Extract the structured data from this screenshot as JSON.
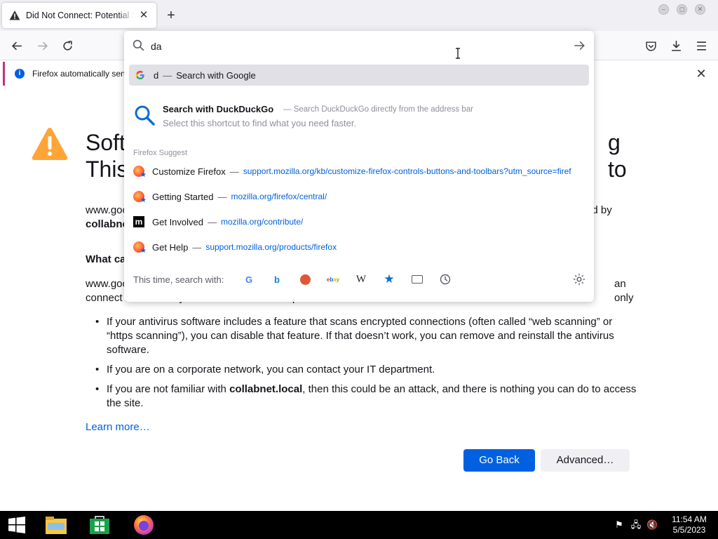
{
  "window": {
    "tab_title": "Did Not Connect: Potential Security Issue",
    "new_tab_symbol": "+"
  },
  "notification": {
    "text": "Firefox automatically sen"
  },
  "page": {
    "heading_line1": "Soft",
    "heading_line2": "This",
    "heading_tail": "g to",
    "para1_start": "www.goo",
    "para1_end": "ed by",
    "para1_bold": "collabne",
    "what_heading": "What ca",
    "para2_start": "www.goo",
    "para2_end": "an only",
    "para2_line2": "connect to it securely. You can’t add an exception to visit this site.",
    "bullets": [
      "If your antivirus software includes a feature that scans encrypted connections (often called “web scanning” or “https scanning”), you can disable that feature. If that doesn’t work, you can remove and reinstall the antivirus software.",
      "If you are on a corporate network, you can contact your IT department."
    ],
    "bullet3_before": "If you are not familiar with ",
    "bullet3_bold": "collabnet.local",
    "bullet3_after": ", then this could be an attack, and there is nothing you can do to access the site.",
    "learn_more": "Learn more…",
    "go_back": "Go Back",
    "advanced": "Advanced…"
  },
  "urlbar": {
    "input_value": "da",
    "google": {
      "term": "d",
      "dash": "—",
      "label": "Search with Google"
    },
    "ddg": {
      "title": "Search with DuckDuckGo",
      "subtitle": "— Search DuckDuckGo directly from the address bar",
      "desc": "Select this shortcut to find what you need faster."
    },
    "suggest_label": "Firefox Suggest",
    "suggestions": [
      {
        "title": "Customize Firefox",
        "url": "support.mozilla.org/kb/customize-firefox-controls-buttons-and-toolbars?utm_source=firef",
        "icon": "firefox-icon"
      },
      {
        "title": "Getting Started",
        "url": "mozilla.org/firefox/central/",
        "icon": "firefox-icon"
      },
      {
        "title": "Get Involved",
        "url": "mozilla.org/contribute/",
        "icon": "mozilla-icon"
      },
      {
        "title": "Get Help",
        "url": "support.mozilla.org/products/firefox",
        "icon": "firefox-icon"
      }
    ],
    "search_with_label": "This time, search with:",
    "engines": [
      "google",
      "bing",
      "duckduckgo",
      "ebay",
      "wikipedia",
      "bookmarks",
      "tabs",
      "history"
    ]
  },
  "taskbar": {
    "time": "11:54 AM",
    "date": "5/5/2023"
  },
  "colors": {
    "accent": "#0061e0",
    "warning": "#ffa436",
    "notif_border": "#c4307e"
  }
}
